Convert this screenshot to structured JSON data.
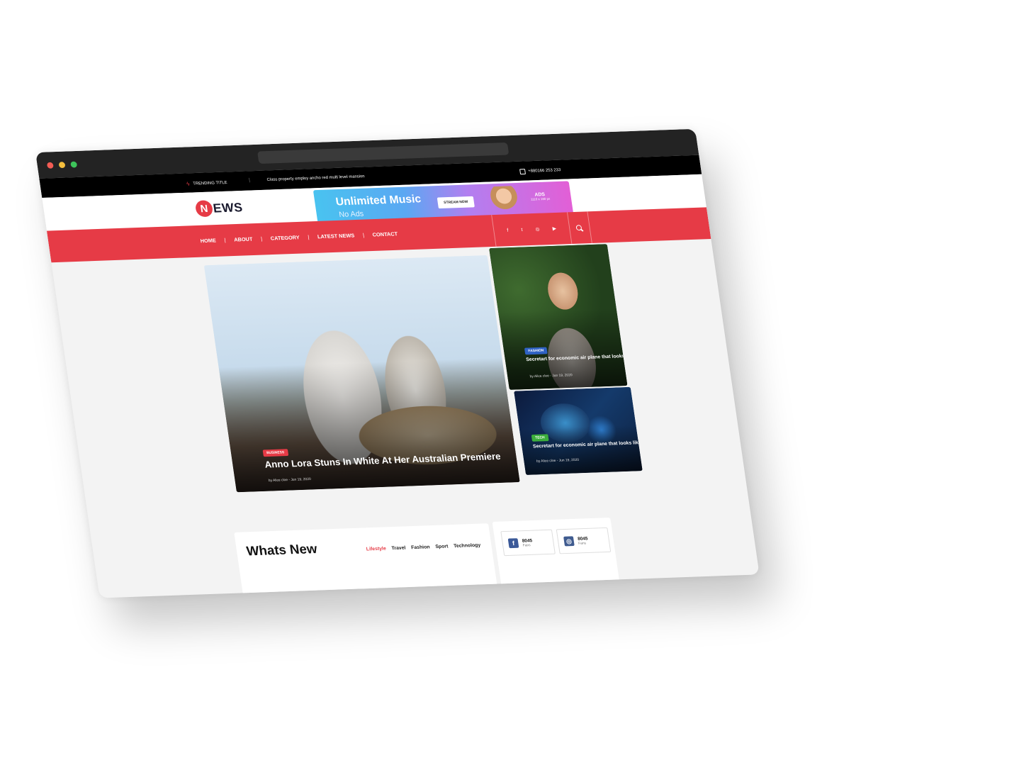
{
  "topbar": {
    "trending_label": "TRENDING TITLE",
    "ticker": "Class property employ ancho red multi level mansion",
    "phone": "+880166 253 233"
  },
  "header": {
    "logo_first": "N",
    "logo_rest": "EWS",
    "ad": {
      "title": "Unlimited Music",
      "subtitle": "No Ads",
      "button": "STREAM NOW",
      "label": "ADS",
      "size": "1110 x 180 px"
    }
  },
  "nav": {
    "items": [
      {
        "label": "HOME"
      },
      {
        "label": "ABOUT"
      },
      {
        "label": "CATEGORY"
      },
      {
        "label": "LATEST NEWS"
      },
      {
        "label": "CONTACT"
      }
    ],
    "social_icons": [
      "facebook-icon",
      "twitter-icon",
      "instagram-icon",
      "youtube-icon"
    ],
    "social_glyphs": [
      "f",
      "t",
      "◎",
      "▶"
    ]
  },
  "hero": {
    "main": {
      "category": "BUSINESS",
      "title": "Anno Lora Stuns In White At Her Australian Premiere",
      "meta": "by Alice cloe - Jun 19, 2020",
      "accent": "#e63b46"
    },
    "side": [
      {
        "category": "FASHION",
        "title": "Secretart for economic air plane that looks like",
        "meta": "by Alice cloe - Jun 19, 2020",
        "accent": "#2f62c4"
      },
      {
        "category": "TECH",
        "title": "Secretart for economic air plane that looks like",
        "meta": "by Alice cloe - Jun 19, 2020",
        "accent": "#3cae3c"
      }
    ]
  },
  "whats_new": {
    "title": "Whats New",
    "tabs": [
      "Lifestyle",
      "Travel",
      "Fashion",
      "Sport",
      "Technology"
    ],
    "active_tab": "Lifestyle"
  },
  "fans": [
    {
      "icon": "facebook-icon",
      "glyph": "f",
      "count": "8045",
      "label": "Fans",
      "color": "#3b5998"
    },
    {
      "icon": "instagram-icon",
      "glyph": "◎",
      "count": "8045",
      "label": "Fans",
      "color": "#3f5b8f"
    }
  ],
  "colors": {
    "brand": "#e63b46",
    "chrome": "#232323",
    "dot_red": "#f25c54",
    "dot_yellow": "#f5bf3d",
    "dot_green": "#3dc45a"
  }
}
